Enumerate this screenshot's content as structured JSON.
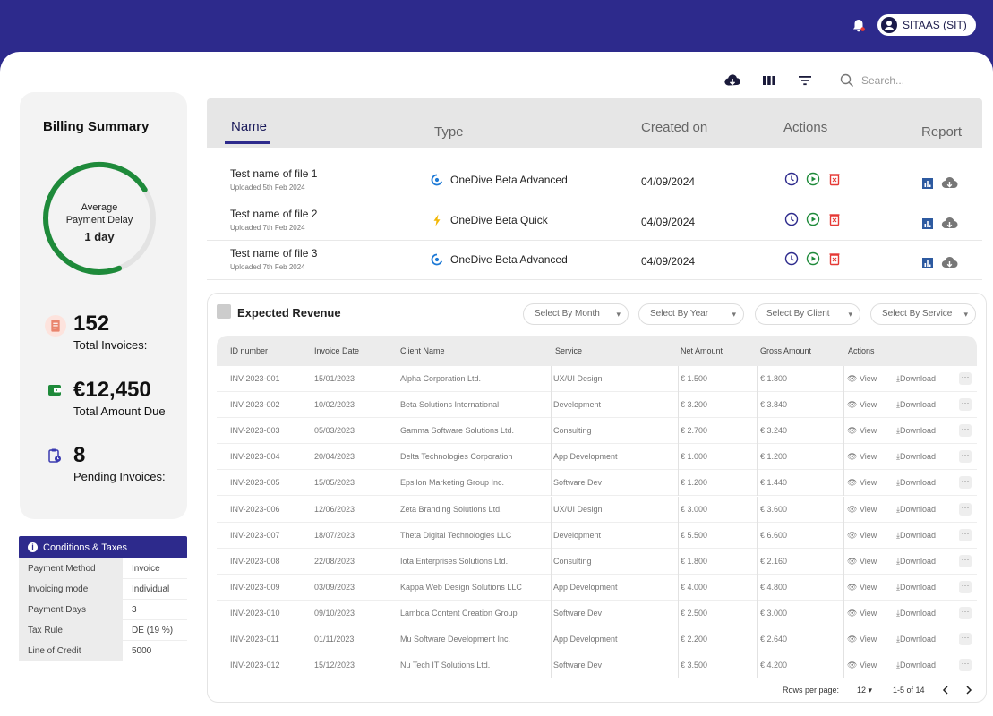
{
  "header": {
    "user_label": "SITAAS (SIT)"
  },
  "toolbar": {
    "search_placeholder": "Search..."
  },
  "summary": {
    "title": "Billing Summary",
    "gauge": {
      "line1": "Average",
      "line2": "Payment Delay",
      "value": "1 day",
      "fill_fraction": 0.72,
      "color": "#1e8a3a"
    },
    "stats": [
      {
        "value": "152",
        "label": "Total Invoices:",
        "icon": "invoice-icon"
      },
      {
        "value": "€12,450",
        "label": "Total Amount Due",
        "icon": "wallet-icon"
      },
      {
        "value": "8",
        "label": "Pending Invoices:",
        "icon": "clipboard-clock-icon"
      }
    ]
  },
  "conditions": {
    "title": "Conditions & Taxes",
    "rows": [
      {
        "key": "Payment Method",
        "value": "Invoice"
      },
      {
        "key": "Invoicing mode",
        "value": "Individual"
      },
      {
        "key": "Payment Days",
        "value": "3"
      },
      {
        "key": "Tax Rule",
        "value": "DE (19 %)"
      },
      {
        "key": "Line of Credit",
        "value": "5000"
      }
    ]
  },
  "files": {
    "headers": {
      "name": "Name",
      "type": "Type",
      "created": "Created on",
      "actions": "Actions",
      "report": "Report"
    },
    "rows": [
      {
        "name": "Test name of file 1",
        "uploaded": "Uploaded 5th Feb 2024",
        "type": "OneDive Beta Advanced",
        "type_icon": "advanced",
        "date": "04/09/2024"
      },
      {
        "name": "Test name of file 2",
        "uploaded": "Uploaded 7th Feb 2024",
        "type": "OneDive Beta Quick",
        "type_icon": "quick",
        "date": "04/09/2024"
      },
      {
        "name": "Test name of file 3",
        "uploaded": "Uploaded 7th Feb 2024",
        "type": "OneDive Beta Advanced",
        "type_icon": "advanced",
        "date": "04/09/2024"
      }
    ]
  },
  "revenue": {
    "title": "Expected Revenue",
    "filters": [
      "Select By Month",
      "Select By Year",
      "Select By Client",
      "Select By Service"
    ],
    "columns": [
      "ID number",
      "Invoice Date",
      "Client Name",
      "Service",
      "Net Amount",
      "Gross Amount",
      "Actions"
    ],
    "view_label": "View",
    "download_label": "Download",
    "more_label": "···",
    "rows": [
      [
        "INV-2023-001",
        "15/01/2023",
        "Alpha Corporation Ltd.",
        "UX/UI Design",
        "€ 1.500",
        "€ 1.800"
      ],
      [
        "INV-2023-002",
        "10/02/2023",
        "Beta Solutions International",
        "Development",
        "€ 3.200",
        "€ 3.840"
      ],
      [
        "INV-2023-003",
        "05/03/2023",
        "Gamma Software Solutions Ltd.",
        "Consulting",
        "€ 2.700",
        "€ 3.240"
      ],
      [
        "INV-2023-004",
        "20/04/2023",
        "Delta Technologies Corporation",
        "App Development",
        "€ 1.000",
        "€ 1.200"
      ],
      [
        "INV-2023-005",
        "15/05/2023",
        "Epsilon Marketing Group Inc.",
        "Software Dev",
        "€ 1.200",
        "€ 1.440"
      ],
      [
        "INV-2023-006",
        "12/06/2023",
        "Zeta Branding Solutions Ltd.",
        "UX/UI Design",
        "€ 3.000",
        "€ 3.600"
      ],
      [
        "INV-2023-007",
        "18/07/2023",
        "Theta Digital Technologies LLC",
        "Development",
        "€ 5.500",
        "€ 6.600"
      ],
      [
        "INV-2023-008",
        "22/08/2023",
        "Iota Enterprises Solutions Ltd.",
        "Consulting",
        "€ 1.800",
        "€ 2.160"
      ],
      [
        "INV-2023-009",
        "03/09/2023",
        "Kappa Web Design Solutions LLC",
        "App Development",
        "€ 4.000",
        "€ 4.800"
      ],
      [
        "INV-2023-010",
        "09/10/2023",
        "Lambda Content Creation Group",
        "Software Dev",
        "€ 2.500",
        "€ 3.000"
      ],
      [
        "INV-2023-011",
        "01/11/2023",
        "Mu Software Development Inc.",
        "App Development",
        "€ 2.200",
        "€ 2.640"
      ],
      [
        "INV-2023-012",
        "15/12/2023",
        "Nu Tech IT Solutions Ltd.",
        "Software Dev",
        "€ 3.500",
        "€ 4.200"
      ]
    ],
    "pager": {
      "rows_label": "Rows per page:",
      "rows_value": "12",
      "range": "1-5 of 14"
    }
  }
}
